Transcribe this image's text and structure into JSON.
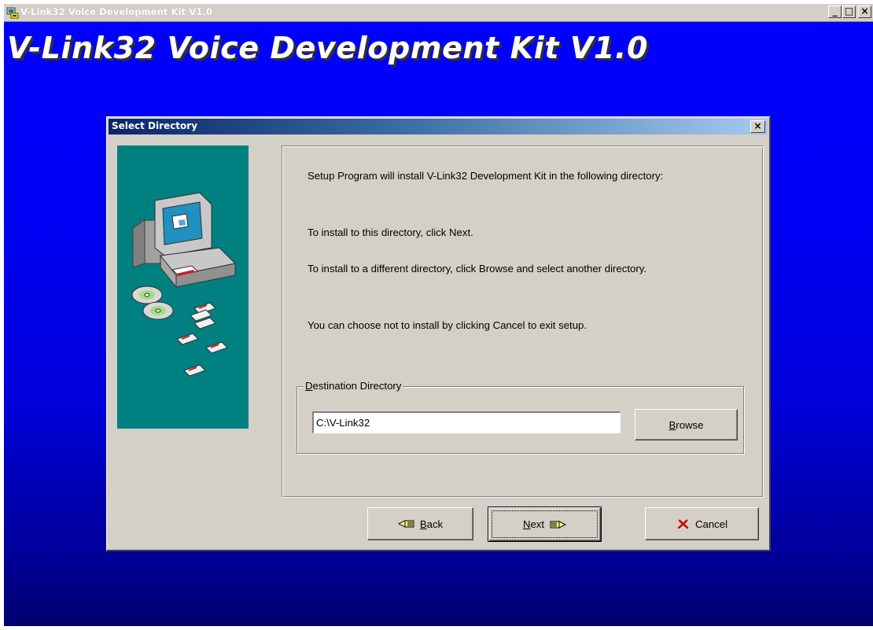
{
  "window": {
    "title": "V-Link32 Voice Development Kit V1.0",
    "minimize_symbol": "_",
    "maximize_symbol": "□",
    "close_symbol": "×"
  },
  "banner": {
    "title": "V-Link32 Voice Development Kit V1.0"
  },
  "dialog": {
    "title": "Select Directory",
    "close_symbol": "×",
    "messages": [
      "Setup Program will install V-Link32 Development Kit in the following directory:",
      "To install to this directory, click Next.",
      "To install to a different directory, click Browse and select another directory.",
      "You can choose not to install by clicking Cancel to exit setup."
    ],
    "destination": {
      "label": "Destination Directory",
      "label_mnemonic": "D",
      "label_rest": "estination Directory",
      "path": "C:\\V-Link32"
    },
    "buttons": {
      "browse": {
        "mnemonic": "B",
        "rest": "rowse"
      },
      "back": {
        "mnemonic": "B",
        "rest": "ack",
        "icon": "hand-pointing-left-icon"
      },
      "next": {
        "mnemonic": "N",
        "rest": "ext",
        "icon": "hand-pointing-right-icon"
      },
      "cancel": {
        "label": "Cancel",
        "icon": "red-x-icon"
      }
    }
  },
  "colors": {
    "background_top": "#0000ff",
    "background_bottom": "#000070",
    "dialog_face": "#d4d0c8",
    "dialog_title_start": "#0a246a",
    "side_panel": "#008080",
    "cancel_icon": "#cc0000"
  }
}
